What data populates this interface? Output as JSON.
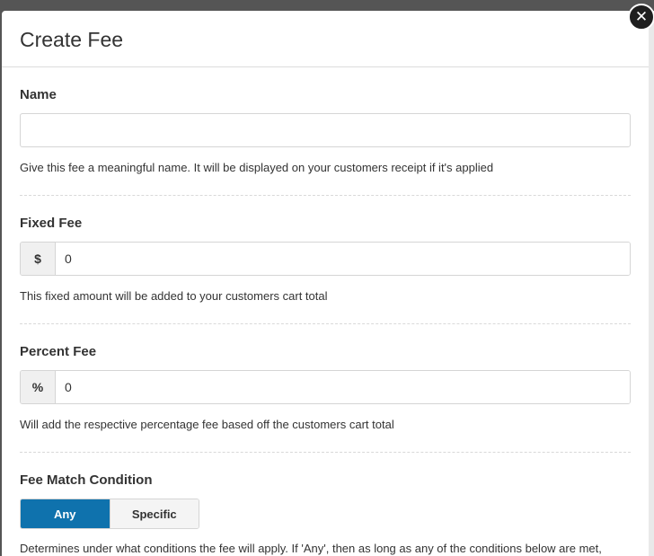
{
  "modal": {
    "title": "Create Fee",
    "close_glyph": "✕"
  },
  "name_field": {
    "label": "Name",
    "value": "",
    "placeholder": "",
    "help": "Give this fee a meaningful name. It will be displayed on your customers receipt if it's applied"
  },
  "fixed_fee": {
    "label": "Fixed Fee",
    "addon": "$",
    "value": "0",
    "help": "This fixed amount will be added to your customers cart total"
  },
  "percent_fee": {
    "label": "Percent Fee",
    "addon": "%",
    "value": "0",
    "help": "Will add the respective percentage fee based off the customers cart total"
  },
  "match_condition": {
    "label": "Fee Match Condition",
    "options": [
      "Any",
      "Specific"
    ],
    "selected": "Any",
    "help": "Determines under what conditions the fee will apply. If 'Any', then as long as any of the conditions below are met,"
  },
  "colors": {
    "accent": "#0f72ad"
  }
}
